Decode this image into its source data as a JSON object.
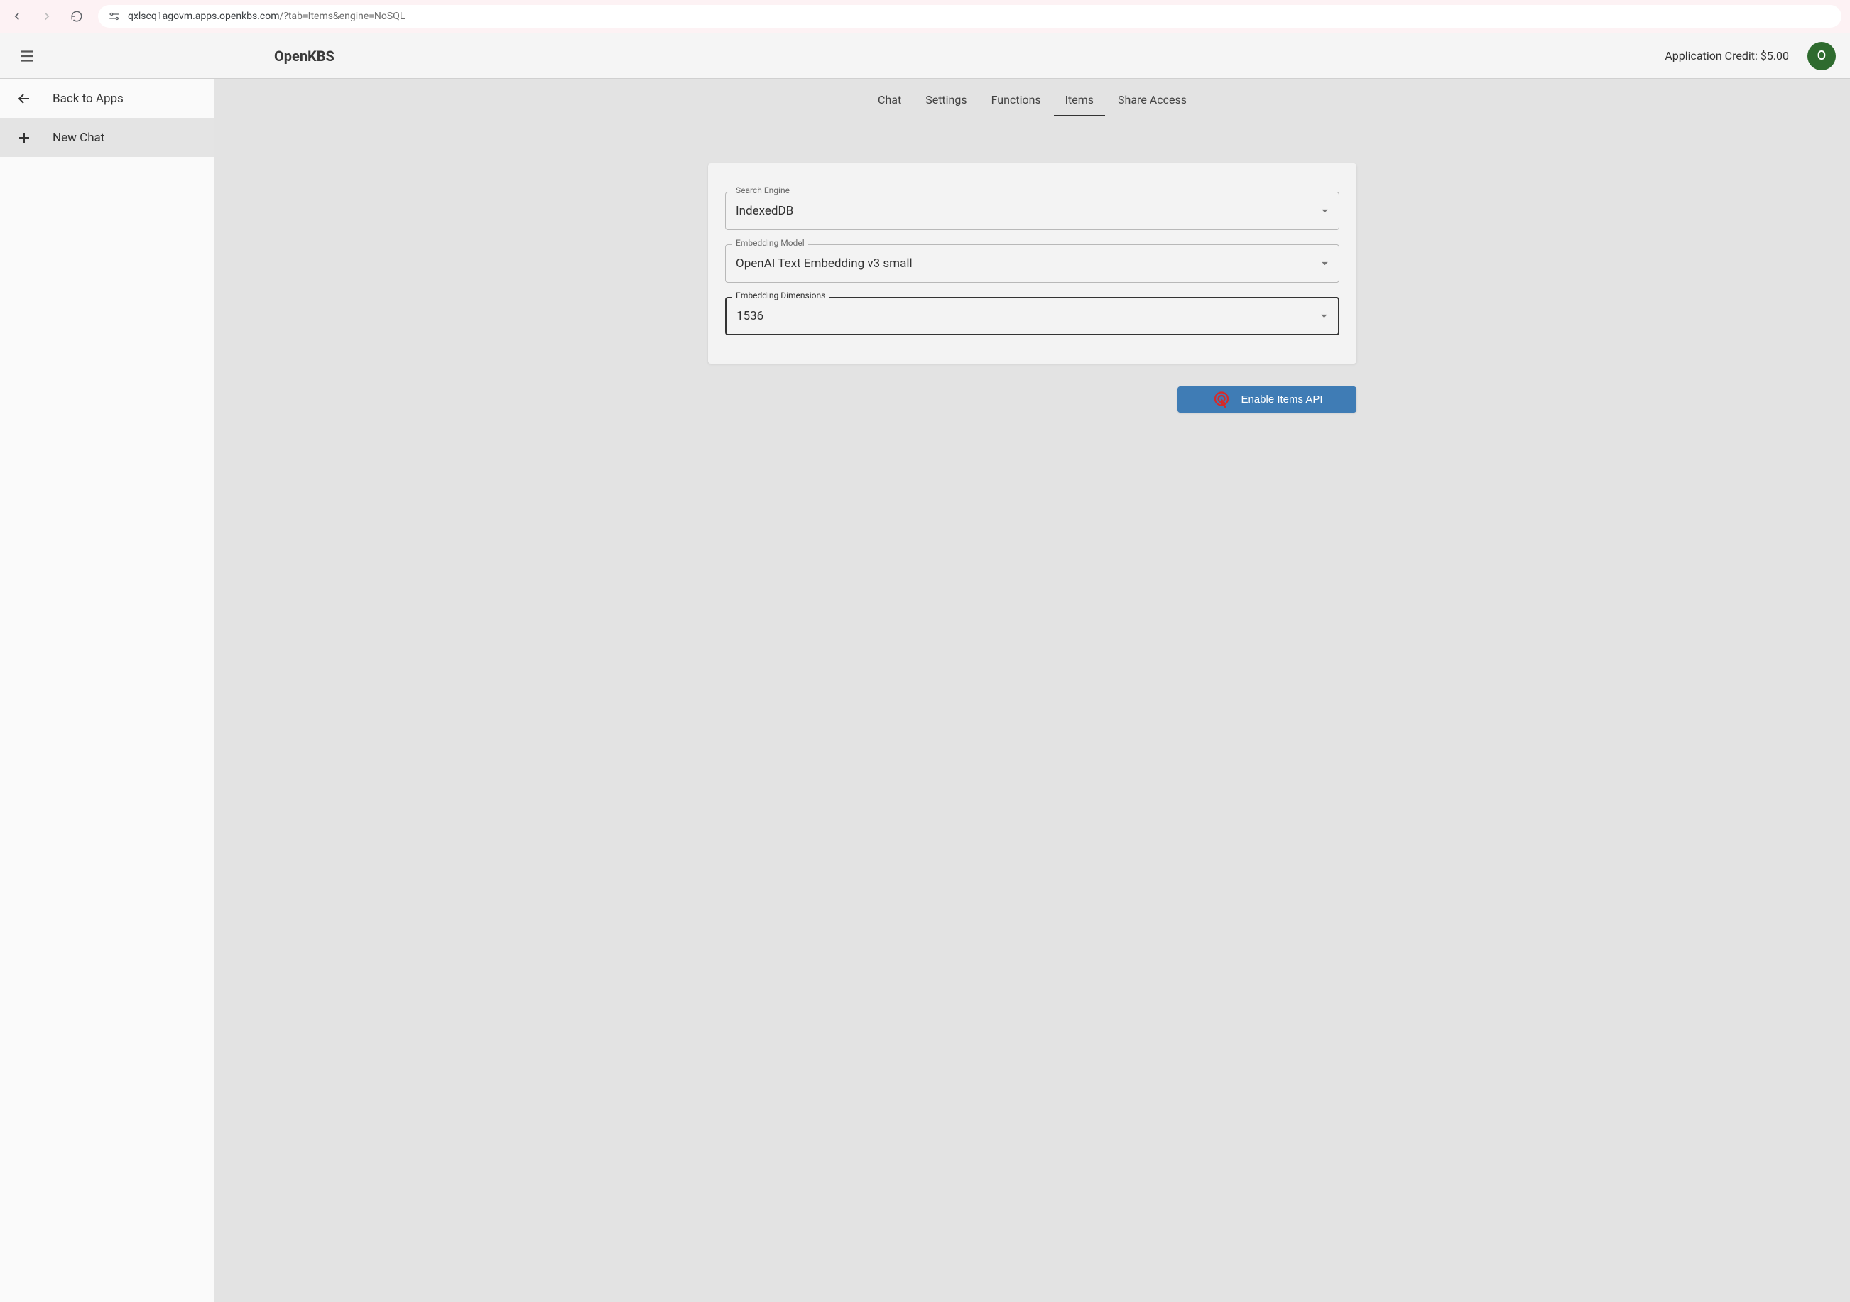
{
  "browser": {
    "url_host": "qxlscq1agovm.apps.openkbs.com",
    "url_path": "/?tab=Items&engine=NoSQL"
  },
  "header": {
    "title": "OpenKBS",
    "credit_label": "Application Credit: $5.00",
    "avatar_letter": "O"
  },
  "sidebar": {
    "back_label": "Back to Apps",
    "new_chat_label": "New Chat"
  },
  "tabs": {
    "chat": "Chat",
    "settings": "Settings",
    "functions": "Functions",
    "items": "Items",
    "share": "Share Access",
    "active": "items"
  },
  "form": {
    "search_engine": {
      "label": "Search Engine",
      "value": "IndexedDB"
    },
    "embedding_model": {
      "label": "Embedding Model",
      "value": "OpenAI Text Embedding v3 small"
    },
    "embedding_dimensions": {
      "label": "Embedding Dimensions",
      "value": "1536"
    }
  },
  "action": {
    "enable_label": "Enable Items API"
  }
}
